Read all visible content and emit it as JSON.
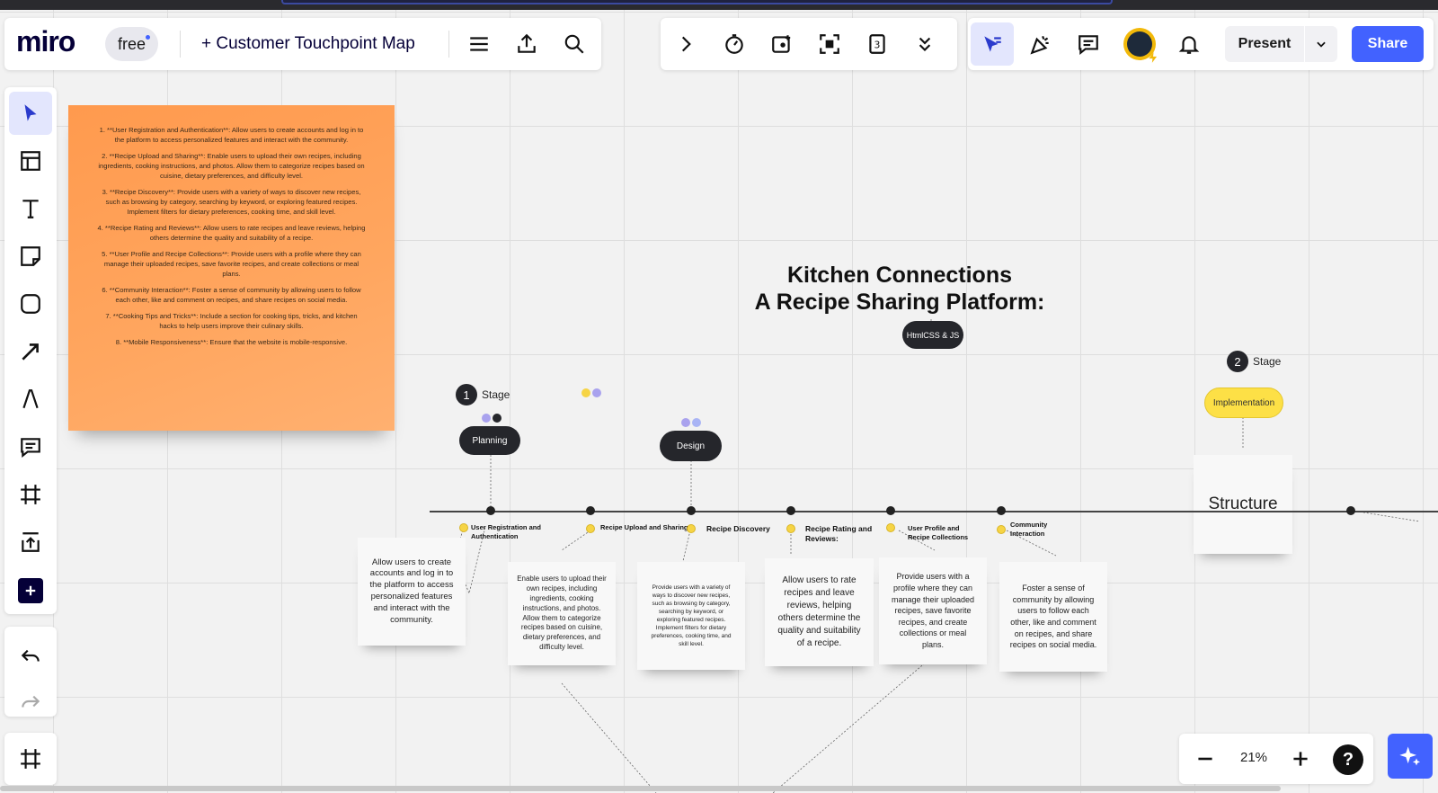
{
  "app": {
    "logo": "miro",
    "plan_badge": "free",
    "board_title": "+ Customer Touchpoint Map"
  },
  "toolbar_right": {
    "present_label": "Present",
    "share_label": "Share"
  },
  "left_tools": [
    "select-tool",
    "templates-tool",
    "text-tool",
    "sticky-note-tool",
    "shape-tool",
    "connection-line-tool",
    "pen-tool",
    "comment-tool",
    "frame-tool",
    "upload-tool",
    "more-apps-tool",
    "undo",
    "redo"
  ],
  "sticky_note": {
    "paragraphs": [
      "1. **User Registration and Authentication**: Allow users to create accounts and log in to the platform to access personalized features and interact with the community.",
      "2. **Recipe Upload and Sharing**: Enable users to upload their own recipes, including ingredients, cooking instructions, and photos. Allow them to categorize recipes based on cuisine, dietary preferences, and difficulty level.",
      "3. **Recipe Discovery**: Provide users with a variety of ways to discover new recipes, such as browsing by category, searching by keyword, or exploring featured recipes. Implement filters for dietary preferences, cooking time, and skill level.",
      "4. **Recipe Rating and Reviews**: Allow users to rate recipes and leave reviews, helping others determine the quality and suitability of a recipe.",
      "5. **User Profile and Recipe Collections**: Provide users with a profile where they can manage their uploaded recipes, save favorite recipes, and create collections or meal plans.",
      "6. **Community Interaction**: Foster a sense of community by allowing users to follow each other, like and comment on recipes, and share recipes on social media.",
      "7. **Cooking Tips and Tricks**: Include a section for cooking tips, tricks, and kitchen hacks to help users improve their culinary skills.",
      "8. **Mobile Responsiveness**: Ensure that the website is mobile-responsive."
    ]
  },
  "board": {
    "heading_line1": "Kitchen Connections",
    "heading_line2": "A Recipe Sharing Platform:",
    "tech_pill": "HtmlCSS & JS",
    "stage1_num": "1",
    "stage1_label": "Stage",
    "stage2_num": "2",
    "stage2_label": "Stage",
    "planning_pill": "Planning",
    "design_pill": "Design",
    "implementation_pill": "Implementation",
    "structure_note": "Structure",
    "steps": [
      "User Registration and Authentication",
      "Recipe Upload and Sharing",
      "Recipe Discovery",
      "Recipe Rating and Reviews:",
      "User Profile and Recipe Collections",
      "Community Interaction"
    ],
    "notes": [
      "Allow users to create accounts and log in to the platform to access personalized features and interact with the community.",
      "Enable users to upload their own recipes, including ingredients, cooking instructions, and photos. Allow them to categorize recipes based on cuisine, dietary preferences, and difficulty level.",
      "Provide users with a variety of ways to discover new recipes, such as browsing by category, searching by keyword, or exploring featured recipes. Implement filters for dietary preferences, cooking time, and skill level.",
      "Allow users to rate recipes and leave reviews, helping others determine the quality and suitability of a recipe.",
      "Provide users with a profile where they can manage their uploaded recipes, save favorite recipes, and create collections or meal plans.",
      "Foster a sense of community by allowing users to follow each other, like and comment on recipes, and share recipes on social media."
    ]
  },
  "zoom": {
    "value": "21%",
    "help": "?"
  },
  "colors": {
    "brand_blue": "#4262ff",
    "sticky_orange": "#ffa65f",
    "pill_dark": "#25262b",
    "pill_yellow": "#fde046"
  }
}
